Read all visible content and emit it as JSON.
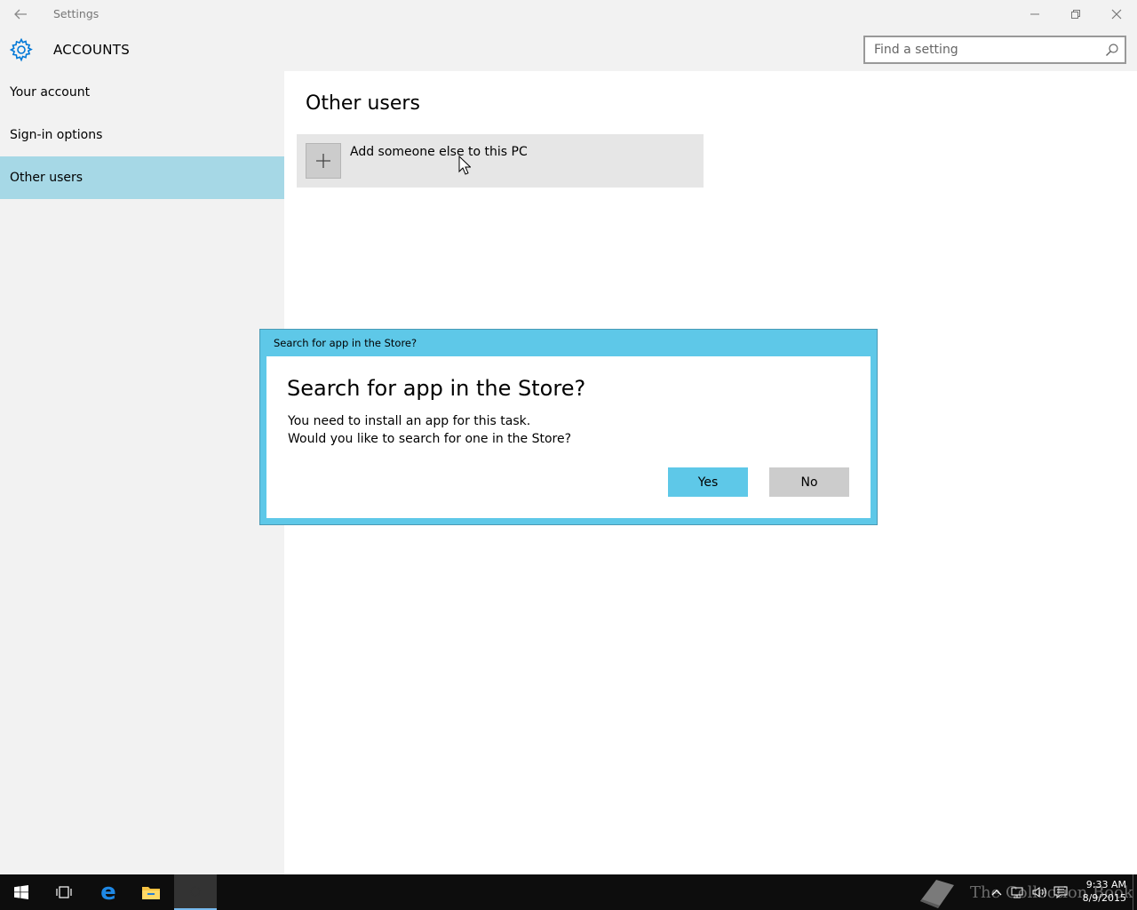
{
  "window": {
    "title": "Settings",
    "minimize_glyph": "—",
    "restore_glyph": "❐",
    "close_glyph": "✕"
  },
  "header": {
    "title": "ACCOUNTS",
    "search_placeholder": "Find a setting",
    "accent_color": "#0078d7"
  },
  "sidebar": {
    "items": [
      {
        "label": "Your account"
      },
      {
        "label": "Sign-in options"
      },
      {
        "label": "Other users",
        "active": true
      }
    ],
    "active_color": "#a6d8e6"
  },
  "main": {
    "title": "Other users",
    "add_user_label": "Add someone else to this PC"
  },
  "dialog": {
    "caption": "Search for app in the Store?",
    "heading": "Search for app in the Store?",
    "line1": "You need to install an app for this task.",
    "line2": "Would you like to search for one in the Store?",
    "yes_label": "Yes",
    "no_label": "No",
    "frame_color": "#5ec8e8"
  },
  "taskbar": {
    "watermark": "The Collection Book",
    "time": "9:33 AM",
    "date": "8/9/2015",
    "icons": [
      "windows-start-icon",
      "task-view-icon",
      "edge-icon",
      "file-explorer-icon",
      "settings-app-icon"
    ]
  }
}
